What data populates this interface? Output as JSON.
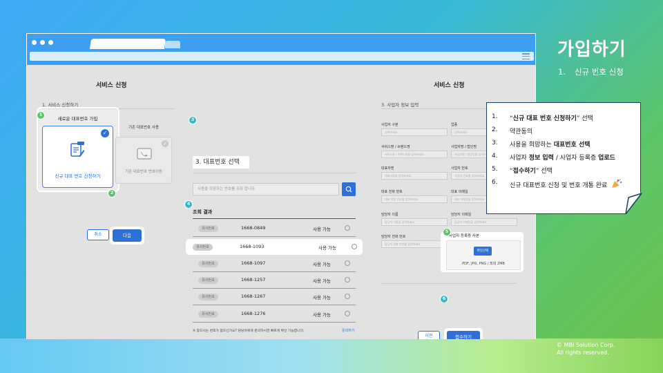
{
  "slide": {
    "title": "가입하기",
    "subtitle_num": "1.",
    "subtitle": "신규 번호 신청",
    "copyright_line1": "© MBI Solution Corp.",
    "copyright_line2": "All rights reserved."
  },
  "left_pane": {
    "title": "서비스 신청",
    "section": "1. 서비스 신청하기",
    "new_card_title": "새로운 대표번호 가입",
    "new_card_label": "신규 대표 번호 신청하기",
    "old_card_title": "기존 대표번호 사용",
    "old_card_label": "기존 대표번호 번호이동",
    "cancel": "취소",
    "next": "다음"
  },
  "middle_pane": {
    "title": "3. 대표번호 선택",
    "search_placeholder": "사용을 희망하는 번호를 조회 합니다.",
    "results_label": "조회 결과",
    "rows": [
      {
        "badge": "유사번호",
        "number": "1668-0849",
        "status": "사용 가능"
      },
      {
        "badge": "유사번호",
        "number": "1668-1093",
        "status": "사용 가능"
      },
      {
        "badge": "유사번호",
        "number": "1668-1097",
        "status": "사용 가능"
      },
      {
        "badge": "유사번호",
        "number": "1668-1257",
        "status": "사용 가능"
      },
      {
        "badge": "유사번호",
        "number": "1668-1267",
        "status": "사용 가능"
      },
      {
        "badge": "유사번호",
        "number": "1668-1276",
        "status": "사용 가능"
      }
    ],
    "selected_index": 1,
    "footnote": "※ 찾으시는 번호가 없으신가요? 담당자에게 문의하시면 빠르게 확인 가능합니다.",
    "inquiry": "문의하기"
  },
  "right_pane": {
    "title": "서비스 신청",
    "section": "3. 사업자 정보 입력",
    "fields": {
      "biz_type_label": "사업자 구분",
      "biz_type_value": "선택하세요",
      "industry_label": "업종",
      "industry_value": "선택하세요",
      "brand_label": "서비스명 / 브랜드명",
      "brand_ph": "서비스명 / 브랜드명을 입력하세요.",
      "company_label": "사업자명 / 법인명",
      "company_ph": "사업자명 / 법인명을 입력하세요.",
      "ceo_label": "대표자명",
      "ceo_ph": "대표자명을 입력하세요.",
      "biz_no_label": "사업자 번호",
      "biz_no_ph": "사업자 번호를 입력하세요.",
      "rep_phone_label": "대표 전화 번호",
      "rep_phone_ph": "대표 전화 번호를 입력하세요.",
      "rep_email_label": "대표 이메일",
      "rep_email_ph": "대표 이메일을 입력하세요.",
      "manager_label": "담당자 이름",
      "manager_ph": "담당자 이름을 입력하세요.",
      "manager_email_label": "담당자 이메일",
      "manager_email_ph": "담당자 이메일을 입력하세요.",
      "manager_phone_label": "담당자 전화 번호",
      "manager_phone_ph": "담당자 전화 번호를 입력하세요."
    },
    "upload_label": "사업자 등록증 사본",
    "upload_button": "파일선택",
    "upload_hint": "PDF, JPG, PNG / 최대 2MB",
    "prev": "이전",
    "submit": "접수하기"
  },
  "markers": [
    "1",
    "2",
    "3",
    "4",
    "5",
    "6"
  ],
  "callout": {
    "s1_n": "1.",
    "s1_a": "“",
    "s1_b": "신규 대표 번호 신청하기",
    "s1_c": "” 선택",
    "s2_n": "2.",
    "s2_a": "약관동의",
    "s3_n": "3.",
    "s3_a": "사용을 희망하는 ",
    "s3_b": "대표번호 선택",
    "s4_n": "4.",
    "s4_a": "사업자 ",
    "s4_b": "정보 입력",
    "s4_c": " / 사업자 등록증 ",
    "s4_d": "업로드",
    "s5_n": "5.",
    "s5_a": "“",
    "s5_b": "접수하기",
    "s5_c": "” 선택",
    "s6_n": "6.",
    "s6_a": "신규 대표번호 신청 및 번호 개통 완료"
  },
  "colors": {
    "accent": "#2e6fd8",
    "marker": "#5cc46a",
    "chrome": "#3c9ff2",
    "navy": "#1d3b63"
  }
}
